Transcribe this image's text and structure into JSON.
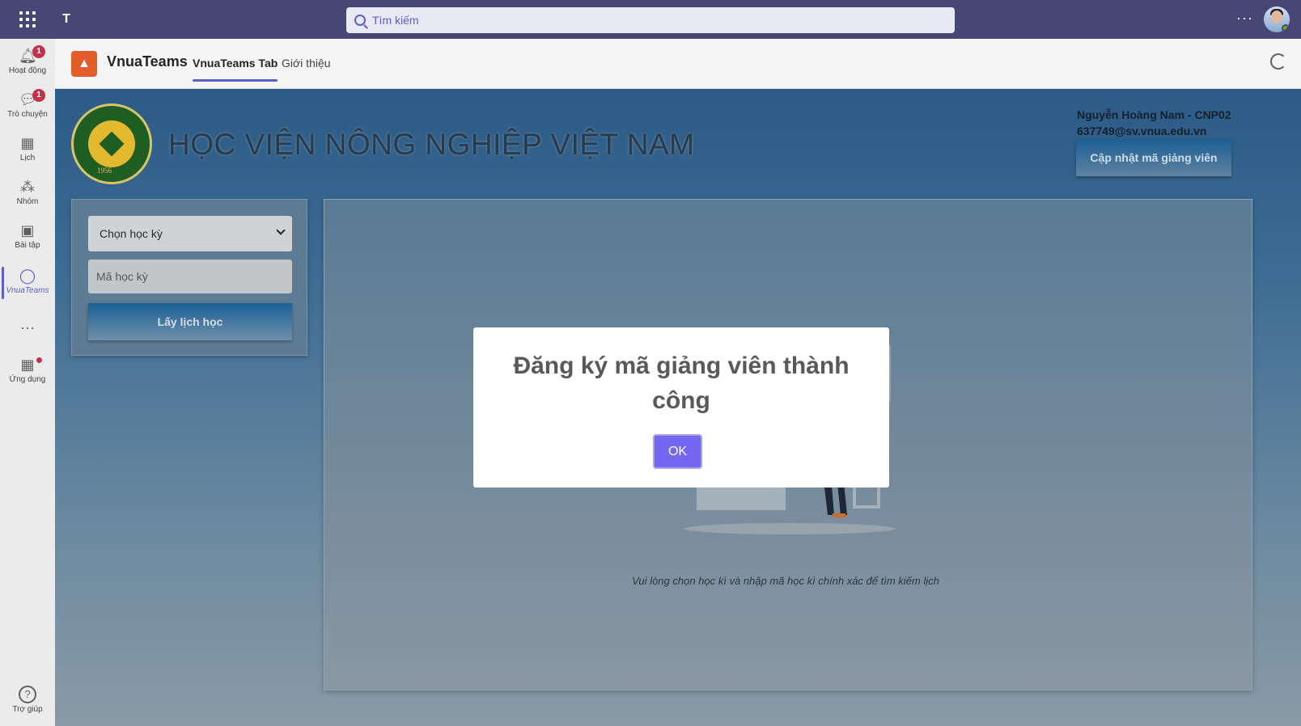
{
  "topbar": {
    "search_placeholder": "Tìm kiếm",
    "more": "···"
  },
  "rail": {
    "items": [
      {
        "label": "Hoạt động",
        "icon": "bell-icon",
        "badge": "1"
      },
      {
        "label": "Trò chuyện",
        "icon": "chat-icon",
        "badge": "1"
      },
      {
        "label": "Lịch",
        "icon": "calendar-icon"
      },
      {
        "label": "Nhóm",
        "icon": "teams-icon"
      },
      {
        "label": "Bài tập",
        "icon": "backpack-icon"
      },
      {
        "label": "VnuaTeams",
        "icon": "app-icon"
      },
      {
        "label": "···",
        "icon": "more-icon"
      },
      {
        "label": "Ứng dụng",
        "icon": "apps-icon"
      }
    ],
    "help_label": "Trợ giúp"
  },
  "app_header": {
    "name": "VnuaTeams",
    "tabs": [
      "VnuaTeams Tab",
      "Giới thiệu"
    ]
  },
  "banner": {
    "title": "HỌC VIỆN NÔNG NGHIỆP VIỆT NAM",
    "seal_year": "1956",
    "user_name": "Nguyễn Hoàng Nam - CNP02",
    "user_email": "637749@sv.vnua.edu.vn",
    "update_button": "Cập nhật mã giảng viên"
  },
  "form": {
    "semester_select": "Chọn học kỳ",
    "semester_code_placeholder": "Mã học kỳ",
    "get_schedule_button": "Lấy lịch học"
  },
  "main": {
    "hint": "Vui lòng chọn học kì và nhập mã học kì chính xác để tìm kiếm lịch"
  },
  "modal": {
    "title": "Đăng ký mã giảng viên thành công",
    "ok": "OK"
  },
  "colors": {
    "teams_purple": "#464775",
    "accent": "#5b5fc7",
    "ok_button": "#7367f0"
  }
}
